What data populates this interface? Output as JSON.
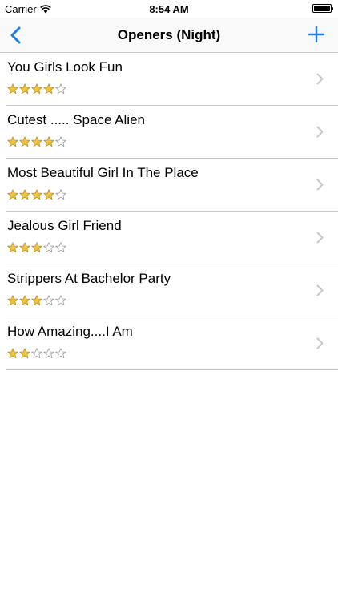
{
  "status_bar": {
    "carrier": "Carrier",
    "time": "8:54 AM"
  },
  "nav": {
    "title": "Openers (Night)",
    "back_icon": "chevron-left-icon",
    "add_icon": "plus-icon",
    "accent_color": "#1a7fe0"
  },
  "list": {
    "items": [
      {
        "title": "You Girls Look Fun",
        "rating": 4
      },
      {
        "title": "Cutest ..... Space Alien",
        "rating": 4
      },
      {
        "title": "Most Beautiful Girl In The Place",
        "rating": 4
      },
      {
        "title": "Jealous Girl Friend",
        "rating": 3
      },
      {
        "title": "Strippers At Bachelor Party",
        "rating": 3
      },
      {
        "title": "How Amazing....I Am",
        "rating": 2
      }
    ],
    "max_rating": 5,
    "star_filled_color": "#f3c43a",
    "star_empty_color": "#ffffff"
  }
}
